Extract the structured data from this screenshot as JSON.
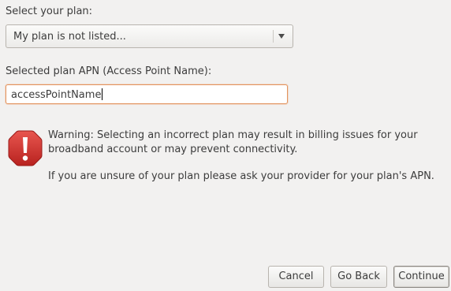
{
  "plan": {
    "label": "Select your plan:",
    "selected": "My plan is not listed..."
  },
  "apn": {
    "label": "Selected plan APN (Access Point Name):",
    "value": "accessPointName"
  },
  "warning": {
    "icon": "error-exclamation-icon",
    "line1": "Warning: Selecting an incorrect plan may result in billing issues for your",
    "line2": "broadband account or may prevent connectivity.",
    "line3": "If you are unsure of your plan please ask your provider for your plan's APN."
  },
  "buttons": {
    "cancel": "Cancel",
    "back": "Go Back",
    "continue": "Continue"
  },
  "colors": {
    "warning_icon": "#c5302d",
    "entry_focus_border": "#e2945f",
    "background": "#f2f1f0"
  }
}
